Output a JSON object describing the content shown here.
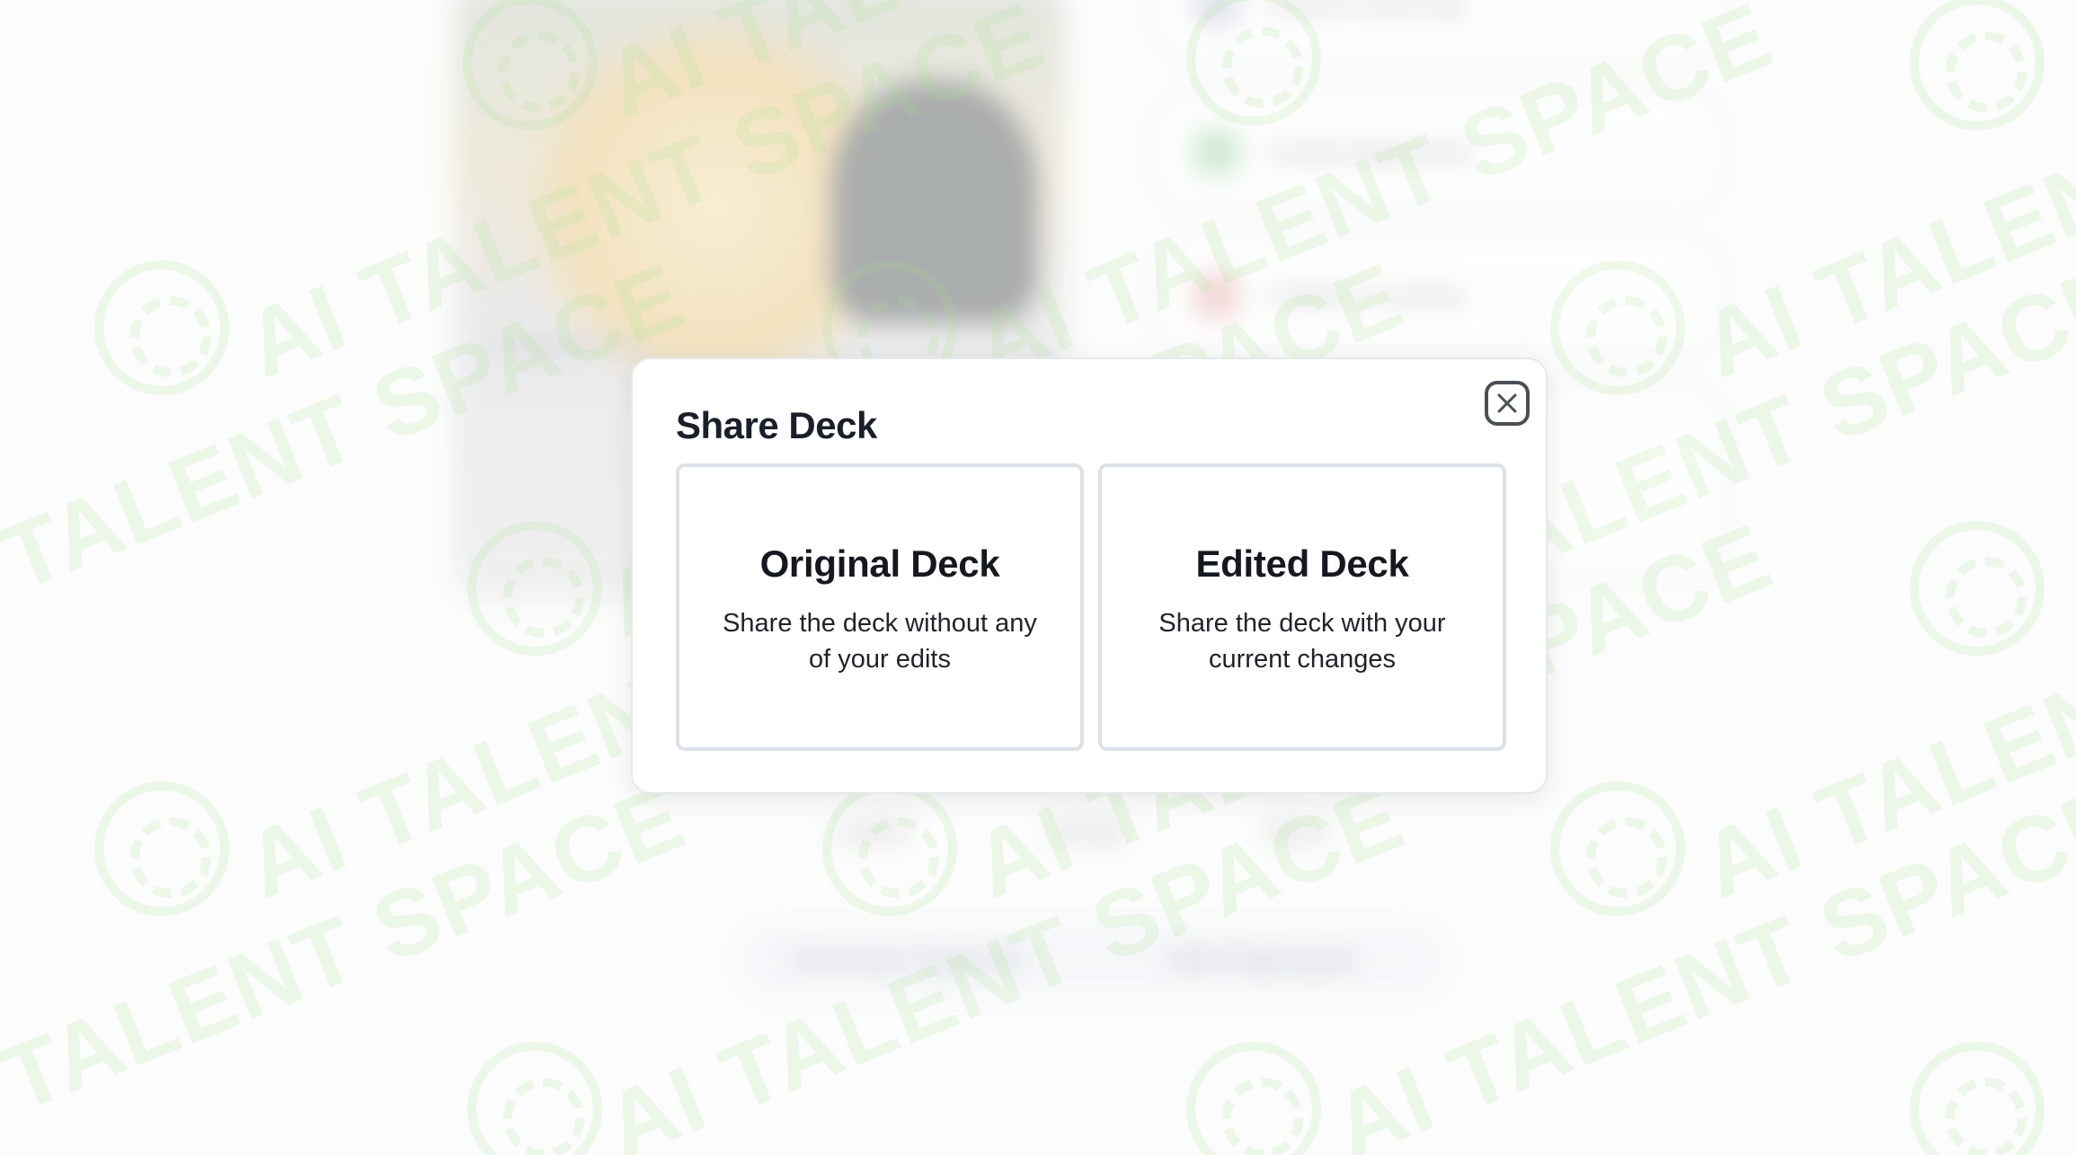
{
  "background": {
    "card_caption": "Peppermint",
    "rows": [
      {
        "label": "Cards Learning",
        "icon": "list-icon",
        "color": "#d9d9e6"
      },
      {
        "label": "Cards Mastered",
        "icon": "check-icon",
        "color": "#bfe3c2"
      },
      {
        "label": "Cards to review",
        "icon": "review-icon",
        "color": "#f0c9c9"
      }
    ],
    "tabs": [
      "Learn",
      "Study",
      "Quiz"
    ],
    "bottom_bar": {
      "left": "Overview Cards 48",
      "right": "Edit Flashcards"
    }
  },
  "watermark": {
    "text": "AI TALENT SPACE"
  },
  "modal": {
    "title": "Share Deck",
    "close_icon": "close-icon",
    "options": [
      {
        "title": "Original Deck",
        "description": "Share the deck without any of your edits"
      },
      {
        "title": "Edited Deck",
        "description": "Share the deck with your current changes"
      }
    ]
  }
}
